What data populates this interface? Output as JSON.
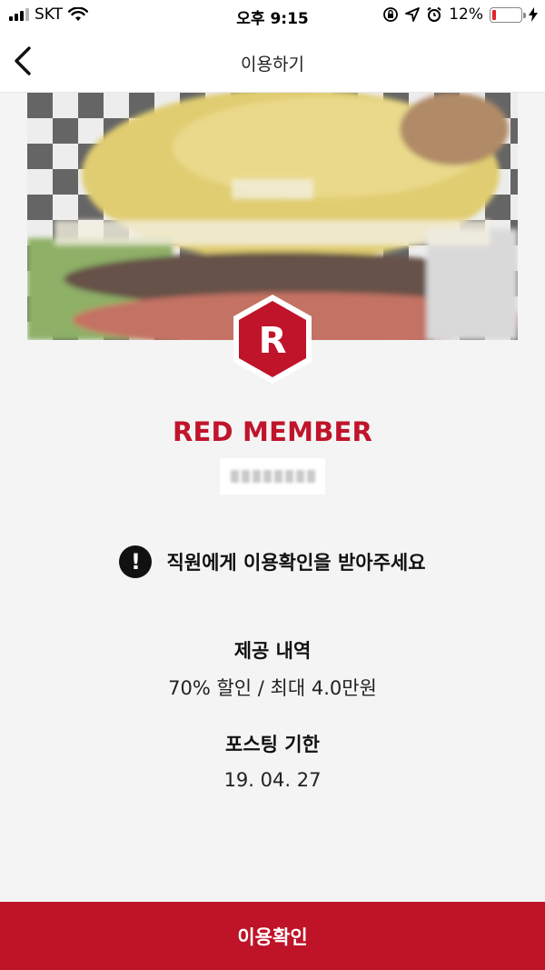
{
  "status_bar": {
    "carrier": "SKT",
    "time": "오후 9:15",
    "battery_percent": "12%",
    "battery_level": 0.12,
    "icons": [
      "signal-icon",
      "wifi-icon",
      "orientation-lock-icon",
      "location-icon",
      "alarm-icon",
      "battery-icon",
      "charging-icon"
    ]
  },
  "nav": {
    "title": "이용하기",
    "back_icon": "chevron-left-icon"
  },
  "badge": {
    "letter": "R",
    "color": "#c0142b"
  },
  "member": {
    "tier": "RED MEMBER"
  },
  "notice": {
    "icon": "exclamation-icon",
    "text": "직원에게 이용확인을 받아주세요"
  },
  "offer": {
    "label": "제공 내역",
    "value": "70% 할인 / 최대 4.0만원"
  },
  "deadline": {
    "label": "포스팅 기한",
    "value": "19. 04. 27"
  },
  "action": {
    "confirm_label": "이용확인"
  },
  "colors": {
    "accent": "#c0142b",
    "button": "#bf1328",
    "background": "#f4f4f4"
  }
}
